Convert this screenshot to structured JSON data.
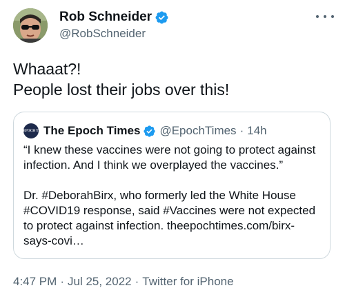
{
  "author": {
    "name": "Rob Schneider",
    "handle": "@RobSchneider",
    "verified_color": "#1d9bf0"
  },
  "tweet": {
    "lines": [
      "Whaaat?!",
      "People lost their jobs over this!"
    ]
  },
  "quote": {
    "logo_text": "THE EPOCH TIMES",
    "name": "The Epoch Times",
    "handle": "@EpochTimes",
    "separator": "·",
    "time": "14h",
    "paragraph1": [
      "“I knew these vaccines were not going to protect against",
      "infection. And I think we overplayed the vaccines.”"
    ],
    "paragraph2": [
      "Dr. #DeborahBirx, who formerly led the White House",
      "#COVID19 response, said #Vaccines were not expected",
      "to protect against infection. theepochtimes.com/birx-",
      "says-covi…"
    ]
  },
  "meta": {
    "time": "4:47 PM",
    "separator1": "·",
    "date": "Jul 25, 2022",
    "separator2": "·",
    "source": "Twitter for iPhone"
  },
  "icons": {
    "more": "more-options-icon",
    "verified": "verified-badge-icon"
  }
}
